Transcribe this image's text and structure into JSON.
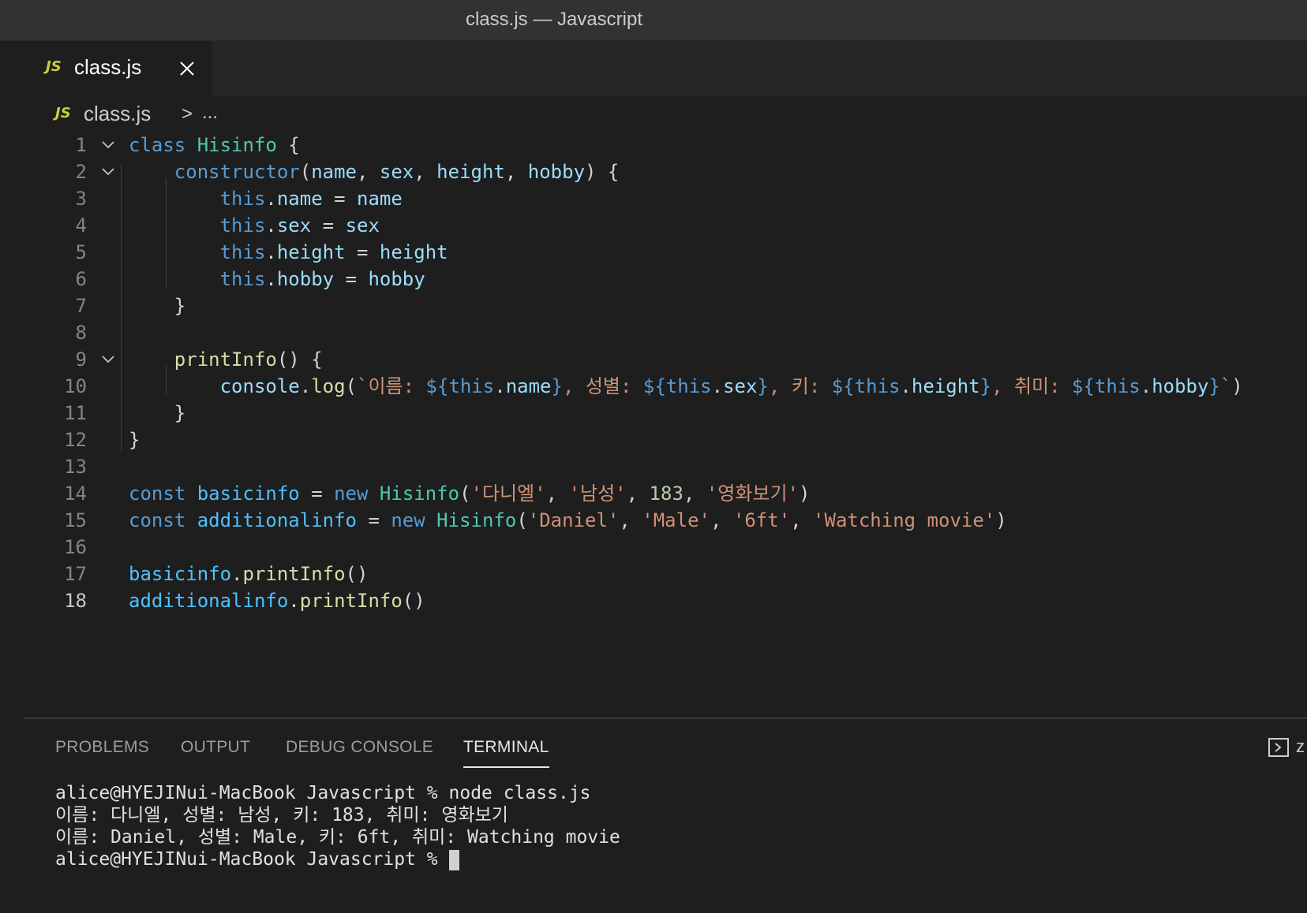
{
  "window": {
    "title": "class.js — Javascript"
  },
  "tab": {
    "icon_label": "JS",
    "label": "class.js"
  },
  "breadcrumb": {
    "icon_label": "JS",
    "file": "class.js",
    "separator": ">",
    "more": "..."
  },
  "editor": {
    "current_line": 18,
    "lines": [
      {
        "num": "1",
        "fold": true,
        "tokens": [
          [
            "k",
            "class"
          ],
          [
            "p",
            " "
          ],
          [
            "t",
            "Hisinfo"
          ],
          [
            "p",
            " {"
          ]
        ]
      },
      {
        "num": "2",
        "fold": true,
        "tokens": [
          [
            "p",
            "    "
          ],
          [
            "k",
            "constructor"
          ],
          [
            "p",
            "("
          ],
          [
            "v",
            "name"
          ],
          [
            "p",
            ", "
          ],
          [
            "v",
            "sex"
          ],
          [
            "p",
            ", "
          ],
          [
            "v",
            "height"
          ],
          [
            "p",
            ", "
          ],
          [
            "v",
            "hobby"
          ],
          [
            "p",
            ") {"
          ]
        ]
      },
      {
        "num": "3",
        "fold": false,
        "tokens": [
          [
            "p",
            "        "
          ],
          [
            "k",
            "this"
          ],
          [
            "p",
            "."
          ],
          [
            "v",
            "name"
          ],
          [
            "p",
            " = "
          ],
          [
            "v",
            "name"
          ]
        ]
      },
      {
        "num": "4",
        "fold": false,
        "tokens": [
          [
            "p",
            "        "
          ],
          [
            "k",
            "this"
          ],
          [
            "p",
            "."
          ],
          [
            "v",
            "sex"
          ],
          [
            "p",
            " = "
          ],
          [
            "v",
            "sex"
          ]
        ]
      },
      {
        "num": "5",
        "fold": false,
        "tokens": [
          [
            "p",
            "        "
          ],
          [
            "k",
            "this"
          ],
          [
            "p",
            "."
          ],
          [
            "v",
            "height"
          ],
          [
            "p",
            " = "
          ],
          [
            "v",
            "height"
          ]
        ]
      },
      {
        "num": "6",
        "fold": false,
        "tokens": [
          [
            "p",
            "        "
          ],
          [
            "k",
            "this"
          ],
          [
            "p",
            "."
          ],
          [
            "v",
            "hobby"
          ],
          [
            "p",
            " = "
          ],
          [
            "v",
            "hobby"
          ]
        ]
      },
      {
        "num": "7",
        "fold": false,
        "tokens": [
          [
            "p",
            "    }"
          ]
        ]
      },
      {
        "num": "8",
        "fold": false,
        "tokens": []
      },
      {
        "num": "9",
        "fold": true,
        "tokens": [
          [
            "p",
            "    "
          ],
          [
            "f",
            "printInfo"
          ],
          [
            "p",
            "() {"
          ]
        ]
      },
      {
        "num": "10",
        "fold": false,
        "tokens": [
          [
            "p",
            "        "
          ],
          [
            "v",
            "console"
          ],
          [
            "p",
            "."
          ],
          [
            "f",
            "log"
          ],
          [
            "p",
            "("
          ],
          [
            "s",
            "`이름: "
          ],
          [
            "k",
            "${"
          ],
          [
            "k",
            "this"
          ],
          [
            "p",
            "."
          ],
          [
            "v",
            "name"
          ],
          [
            "k",
            "}"
          ],
          [
            "s",
            ", 성별: "
          ],
          [
            "k",
            "${"
          ],
          [
            "k",
            "this"
          ],
          [
            "p",
            "."
          ],
          [
            "v",
            "sex"
          ],
          [
            "k",
            "}"
          ],
          [
            "s",
            ", 키: "
          ],
          [
            "k",
            "${"
          ],
          [
            "k",
            "this"
          ],
          [
            "p",
            "."
          ],
          [
            "v",
            "height"
          ],
          [
            "k",
            "}"
          ],
          [
            "s",
            ", 취미: "
          ],
          [
            "k",
            "${"
          ],
          [
            "k",
            "this"
          ],
          [
            "p",
            "."
          ],
          [
            "v",
            "hobby"
          ],
          [
            "k",
            "}"
          ],
          [
            "s",
            "`"
          ],
          [
            "p",
            ")"
          ]
        ]
      },
      {
        "num": "11",
        "fold": false,
        "tokens": [
          [
            "p",
            "    }"
          ]
        ]
      },
      {
        "num": "12",
        "fold": false,
        "tokens": [
          [
            "p",
            "}"
          ]
        ]
      },
      {
        "num": "13",
        "fold": false,
        "tokens": []
      },
      {
        "num": "14",
        "fold": false,
        "tokens": [
          [
            "k",
            "const"
          ],
          [
            "p",
            " "
          ],
          [
            "c",
            "basicinfo"
          ],
          [
            "p",
            " = "
          ],
          [
            "k",
            "new"
          ],
          [
            "p",
            " "
          ],
          [
            "t",
            "Hisinfo"
          ],
          [
            "p",
            "("
          ],
          [
            "s",
            "'다니엘'"
          ],
          [
            "p",
            ", "
          ],
          [
            "s",
            "'남성'"
          ],
          [
            "p",
            ", "
          ],
          [
            "n",
            "183"
          ],
          [
            "p",
            ", "
          ],
          [
            "s",
            "'영화보기'"
          ],
          [
            "p",
            ")"
          ]
        ]
      },
      {
        "num": "15",
        "fold": false,
        "tokens": [
          [
            "k",
            "const"
          ],
          [
            "p",
            " "
          ],
          [
            "c",
            "additionalinfo"
          ],
          [
            "p",
            " = "
          ],
          [
            "k",
            "new"
          ],
          [
            "p",
            " "
          ],
          [
            "t",
            "Hisinfo"
          ],
          [
            "p",
            "("
          ],
          [
            "s",
            "'Daniel'"
          ],
          [
            "p",
            ", "
          ],
          [
            "s",
            "'Male'"
          ],
          [
            "p",
            ", "
          ],
          [
            "s",
            "'6ft'"
          ],
          [
            "p",
            ", "
          ],
          [
            "s",
            "'Watching movie'"
          ],
          [
            "p",
            ")"
          ]
        ]
      },
      {
        "num": "16",
        "fold": false,
        "tokens": []
      },
      {
        "num": "17",
        "fold": false,
        "tokens": [
          [
            "c",
            "basicinfo"
          ],
          [
            "p",
            "."
          ],
          [
            "f",
            "printInfo"
          ],
          [
            "p",
            "()"
          ]
        ]
      },
      {
        "num": "18",
        "fold": false,
        "tokens": [
          [
            "c",
            "additionalinfo"
          ],
          [
            "p",
            "."
          ],
          [
            "f",
            "printInfo"
          ],
          [
            "p",
            "()"
          ]
        ]
      }
    ]
  },
  "panel": {
    "tabs": [
      {
        "label": "PROBLEMS",
        "active": false
      },
      {
        "label": "OUTPUT",
        "active": false
      },
      {
        "label": "DEBUG CONSOLE",
        "active": false
      },
      {
        "label": "TERMINAL",
        "active": true
      }
    ],
    "right_label": "z",
    "terminal_lines": [
      "alice@HYEJINui-MacBook Javascript % node class.js",
      "이름: 다니엘, 성별: 남성, 키: 183, 취미: 영화보기",
      "이름: Daniel, 성별: Male, 키: 6ft, 취미: Watching movie",
      "alice@HYEJINui-MacBook Javascript % "
    ]
  },
  "colors": {
    "keyword": "#569cd6",
    "type": "#4ec9b0",
    "function": "#dcdcaa",
    "variable": "#9cdcfe",
    "string": "#ce9178",
    "number": "#b5cea8",
    "constant": "#4fc1ff",
    "js_badge": "#cbcb41",
    "background": "#1e1e1e"
  },
  "icons": {
    "tab_close": "close-icon",
    "fold": "chevron-down-icon",
    "terminal": "terminal-icon"
  }
}
